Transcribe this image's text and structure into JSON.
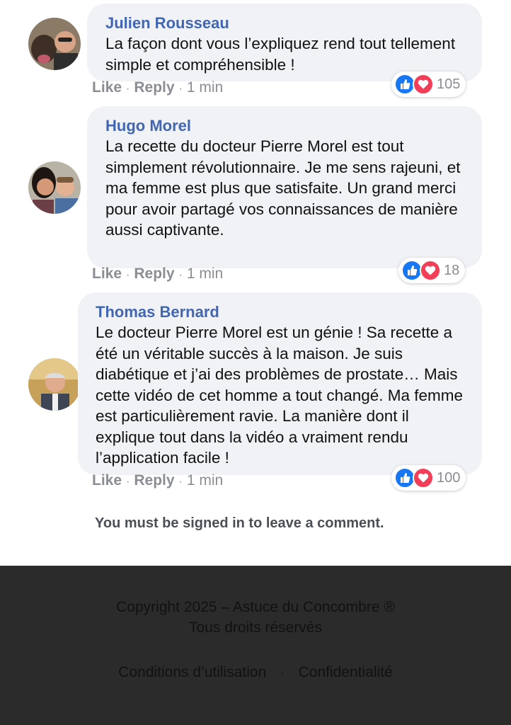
{
  "comments": [
    {
      "author": "Julien Rousseau",
      "text": "La façon dont vous l’expliquez rend tout tellement simple et compréhensible !",
      "like_label": "Like",
      "reply_label": "Reply",
      "time": "1 min",
      "reaction_count": "105"
    },
    {
      "author": "Hugo Morel",
      "text": "La recette du docteur Pierre Morel est tout simplement révolutionnaire. Je me sens rajeuni, et ma femme est plus que satisfaite. Un grand merci pour avoir partagé vos connaissances de manière aussi captivante.",
      "like_label": "Like",
      "reply_label": "Reply",
      "time": "1 min",
      "reaction_count": "18"
    },
    {
      "author": "Thomas Bernard",
      "text": "Le docteur Pierre Morel est un génie ! Sa recette a été un véritable succès à la maison. Je suis diabétique et j’ai des problèmes de prostate… Mais cette vidéo de cet homme a tout changé. Ma femme est particulièrement ravie. La manière dont il explique tout dans la vidéo a vraiment rendu l’application facile !",
      "like_label": "Like",
      "reply_label": "Reply",
      "time": "1 min",
      "reaction_count": "100"
    }
  ],
  "signin_notice": "You must be signed in to leave a comment.",
  "footer": {
    "copyright_line1": "Copyright 2025 – Astuce du Concombre ®",
    "copyright_line2": "Tous droits réservés",
    "terms_link": "Conditions d’utilisation",
    "separator": "·",
    "privacy_link": "Confidentialité"
  },
  "colors": {
    "author_blue": "#4267b2",
    "bubble_bg": "#f0f2f5",
    "like_blue": "#1877f2",
    "love_red": "#f33e58",
    "footer_bg": "#2b2b2b"
  },
  "icons": {
    "like": "thumbs-up-icon",
    "love": "heart-icon"
  }
}
